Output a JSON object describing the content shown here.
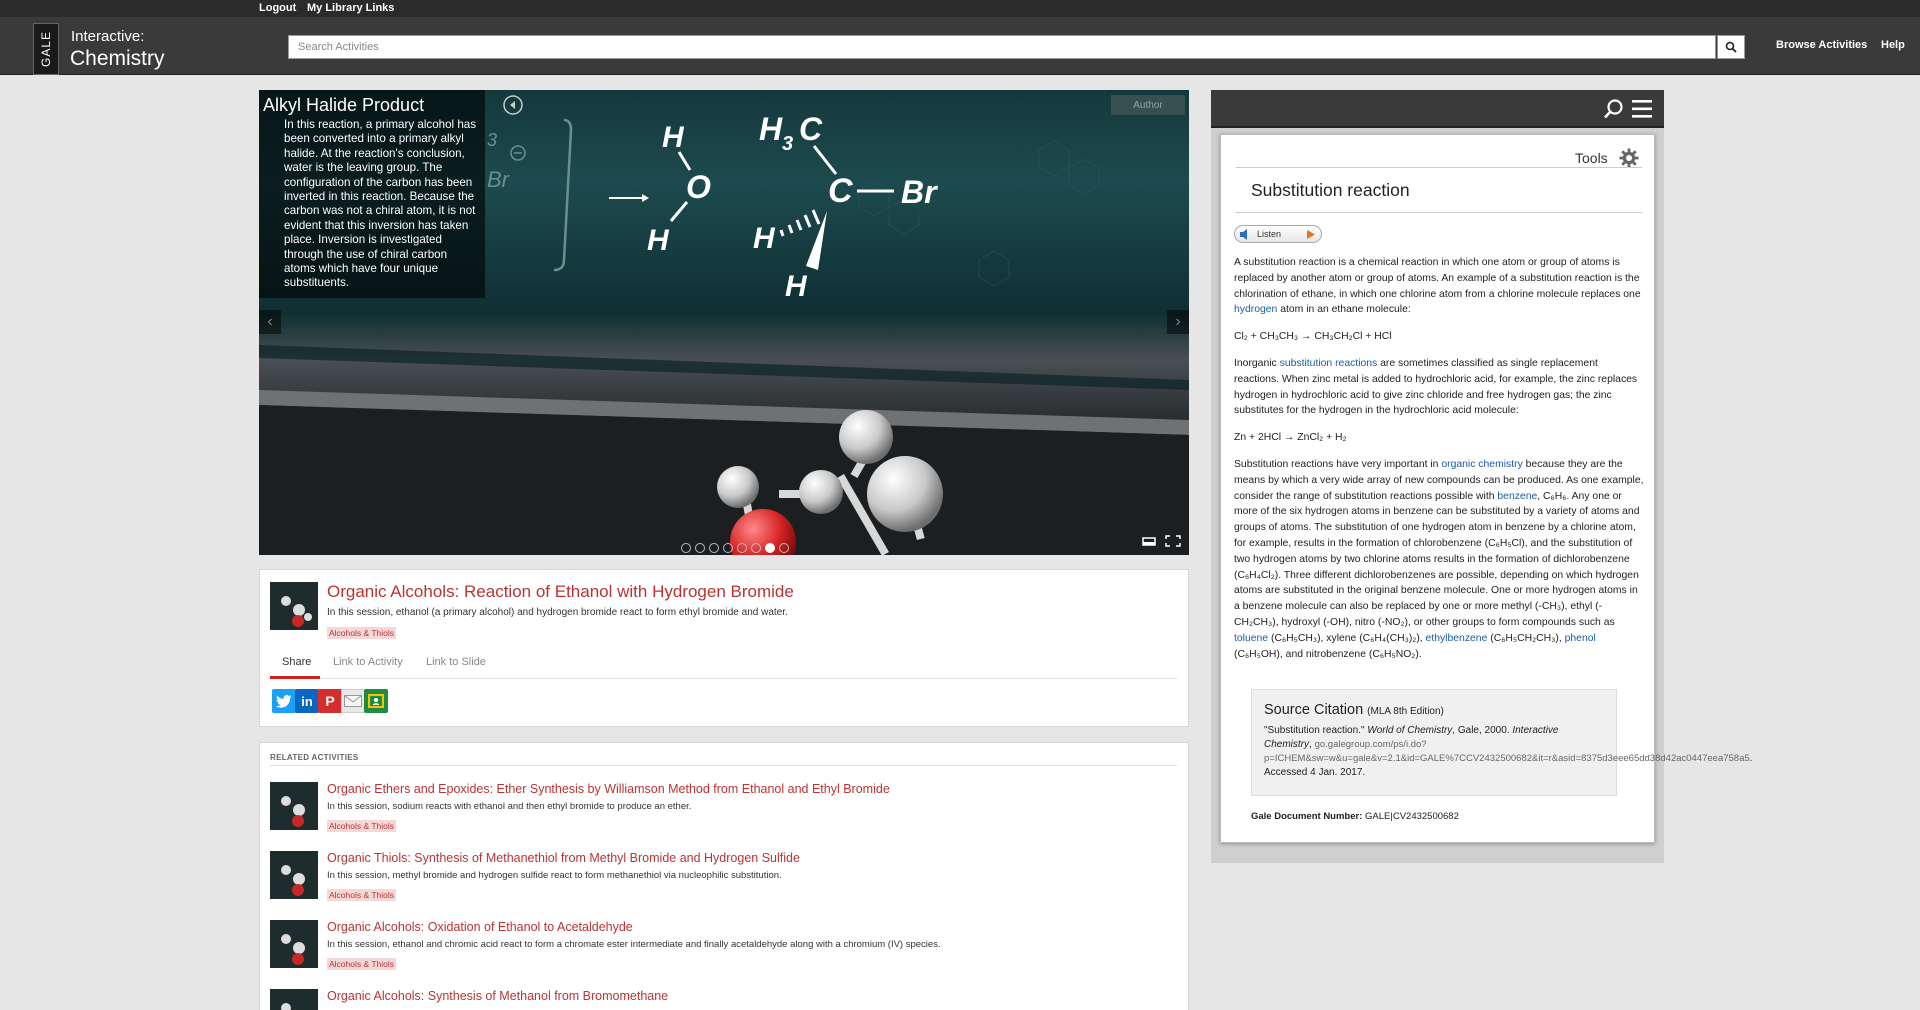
{
  "top_links": {
    "logout": "Logout",
    "library": "My Library Links"
  },
  "header": {
    "logo_text": "GALE",
    "product_line1": "Interactive:",
    "product_line2": "Chemistry",
    "search_placeholder": "Search Activities",
    "browse": "Browse Activities",
    "help": "Help"
  },
  "slide": {
    "caption_title": "Alkyl Halide Product",
    "caption_body": "In this reaction, a primary alcohol has been converted into a primary alkyl halide. At the reaction's conclusion, water is the leaving group. The configuration of the carbon has been inverted in this reaction. Because the carbon was not a chiral atom, it is not evident that this inversion has taken place. Inversion is investigated through the use of chiral carbon atoms which have four unique substituents.",
    "author_btn": "Author",
    "molecule_labels": {
      "h_top": "H",
      "o": "O",
      "h_bottom": "H",
      "ch3": "H",
      "ch3_sub": "3",
      "ch3_c": "C",
      "c": "C",
      "br": "Br",
      "h_left": "H",
      "h_down": "H",
      "faint_3": "3",
      "faint_br": "Br"
    },
    "dots_count": 8,
    "active_dot": 6
  },
  "activity": {
    "title": "Organic Alcohols: Reaction of Ethanol with Hydrogen Bromide",
    "description": "In this session, ethanol (a primary alcohol) and hydrogen bromide react to form ethyl bromide and water.",
    "tag": "Alcohols & Thiols",
    "tabs": {
      "share": "Share",
      "link_activity": "Link to Activity",
      "link_slide": "Link to Slide"
    }
  },
  "related": {
    "label": "RELATED ACTIVITIES",
    "items": [
      {
        "title": "Organic Ethers and Epoxides: Ether Synthesis by Williamson Method from Ethanol and Ethyl Bromide",
        "desc": "In this session, sodium reacts with ethanol and then ethyl bromide to produce an ether.",
        "tag": "Alcohols & Thiols"
      },
      {
        "title": "Organic Thiols: Synthesis of Methanethiol from Methyl Bromide and Hydrogen Sulfide",
        "desc": "In this session, methyl bromide and hydrogen sulfide react to form methanethiol via nucleophilic substitution.",
        "tag": "Alcohols & Thiols"
      },
      {
        "title": "Organic Alcohols: Oxidation of Ethanol to Acetaldehyde",
        "desc": "In this session, ethanol and chromic acid react to form a chromate ester intermediate and finally acetaldehyde along with a chromium (IV) species.",
        "tag": "Alcohols & Thiols"
      },
      {
        "title": "Organic Alcohols: Synthesis of Methanol from Bromomethane",
        "desc": "",
        "tag": ""
      }
    ]
  },
  "panel": {
    "tools_label": "Tools",
    "doc_title": "Substitution reaction",
    "listen": "Listen",
    "p1": {
      "text": "A substitution reaction is a chemical reaction in which one atom or group of atoms is replaced by another atom or group of atoms. An example of a substitution reaction is the chlorination of ethane, in which one chlorine atom from a chlorine molecule replaces one ",
      "link": "hydrogen",
      "tail": " atom in an ethane molecule:"
    },
    "eq1": "Cl₂ + CH₃CH₃ → CH₃CH₂Cl + HCl",
    "p2": {
      "head": "Inorganic ",
      "link": "substitution reactions",
      "text": " are sometimes classified as single replacement reactions. When zinc metal is added to hydrochloric acid, for example, the zinc replaces hydrogen in hydrochloric acid to give zinc chloride and free hydrogen gas; the zinc substitutes for the hydrogen in the hydrochloric acid molecule:"
    },
    "eq2": "Zn + 2HCl → ZnCl₂ + H₂",
    "p3": {
      "a": "Substitution reactions have very important in ",
      "link1": "organic chemistry",
      "b": " because they are the means by which a very wide array of new compounds can be produced. As one example, consider the range of substitution reactions possible with ",
      "link2": "benzene",
      "c": ", C₆H₆. Any one or more of the six hydrogen atoms in benzene can be substituted by a variety of atoms and groups of atoms. The substitution of one hydrogen atom in benzene by a chlorine atom, for example, results in the formation of chlorobenzene (C₆H₅Cl), and the substitution of two hydrogen atoms by two chlorine atoms results in the formation of dichlorobenzene (C₆H₄Cl₂). Three different dichlorobenzenes are possible, depending on which hydrogen atoms are substituted in the original benzene molecule. One or more hydrogen atoms in a benzene molecule can also be replaced by one or more methyl (-CH₃), ethyl (-CH₂CH₃), hydroxyl (-OH), nitro (-NO₂), or other groups to form compounds such as ",
      "link3": "toluene",
      "d": " (C₆H₅CH₃), xylene (C₆H₄(CH₃)₂), ",
      "link4": "ethylbenzene",
      "e": " (C₆H₅CH₂CH₃), ",
      "link5": "phenol",
      "f": " (C₆H₅OH), and nitrobenzene (C₆H₅NO₂)."
    },
    "citation": {
      "heading": "Source Citation",
      "edition": "(MLA 8th Edition)",
      "quote": "\"Substitution reaction.\" ",
      "work": "World of Chemistry",
      "publisher": ", Gale, 2000. ",
      "db": "Interactive Chemistry",
      "url": "go.galegroup.com/ps/i.do?p=ICHEM&sw=w&u=gale&v=2.1&id=GALE%7CCV2432500682&it=r&asid=8375d3eee65dd38d42ac0447eea758a5",
      "accessed": ". Accessed 4 Jan. 2017."
    },
    "docnum_label": "Gale Document Number:",
    "docnum": "GALE|CV2432500682"
  }
}
